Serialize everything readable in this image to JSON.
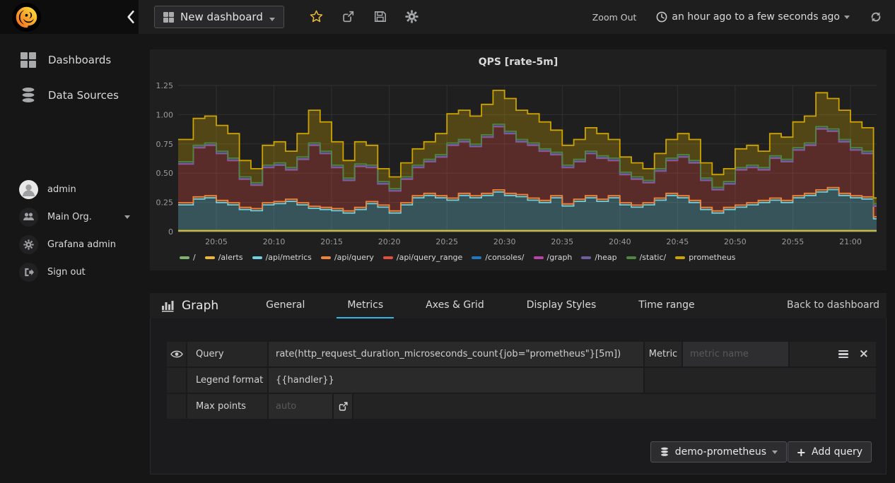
{
  "colors": {
    "accent": "#33b5e5",
    "star": "#EAB839",
    "panel_bg": "#1f1f20",
    "icon_gray": "#9fa0a2"
  },
  "header": {
    "dashboard_title": "New dashboard",
    "zoom_out_label": "Zoom Out",
    "time_range": "an hour ago to a few seconds ago"
  },
  "sidebar": {
    "items": [
      {
        "label": "Dashboards"
      },
      {
        "label": "Data Sources"
      }
    ],
    "user_items": [
      {
        "label": "admin"
      },
      {
        "label": "Main Org."
      },
      {
        "label": "Grafana admin"
      },
      {
        "label": "Sign out"
      }
    ]
  },
  "panel": {
    "title": "QPS [rate-5m]"
  },
  "chart_data": {
    "type": "area",
    "stacked": true,
    "step": true,
    "title": "QPS [rate-5m]",
    "xlabel": "",
    "ylabel": "",
    "ylim": [
      0,
      1.25
    ],
    "grid": true,
    "legend_position": "bottom",
    "x_start": "20:02",
    "x_step_minutes": 1,
    "x_ticks": [
      {
        "m": 5,
        "label": "20:05"
      },
      {
        "m": 10,
        "label": "20:10"
      },
      {
        "m": 15,
        "label": "20:15"
      },
      {
        "m": 20,
        "label": "20:20"
      },
      {
        "m": 25,
        "label": "20:25"
      },
      {
        "m": 30,
        "label": "20:30"
      },
      {
        "m": 35,
        "label": "20:35"
      },
      {
        "m": 40,
        "label": "20:40"
      },
      {
        "m": 45,
        "label": "20:45"
      },
      {
        "m": 50,
        "label": "20:50"
      },
      {
        "m": 55,
        "label": "20:55"
      },
      {
        "m": 60,
        "label": "21:00"
      }
    ],
    "y_ticks": [
      {
        "v": 0,
        "label": "0"
      },
      {
        "v": 0.25,
        "label": "0.25"
      },
      {
        "v": 0.5,
        "label": "0.50"
      },
      {
        "v": 0.75,
        "label": "0.75"
      },
      {
        "v": 1,
        "label": "1.00"
      },
      {
        "v": 1.25,
        "label": "1.25"
      }
    ],
    "series": [
      {
        "name": "/",
        "color": "#7EB26D",
        "value": 0.004
      },
      {
        "name": "/alerts",
        "color": "#EAB839",
        "value": 0.005
      },
      {
        "name": "/api/metrics",
        "color": "#6ED0E0",
        "values": [
          0.22,
          0.27,
          0.28,
          0.24,
          0.22,
          0.18,
          0.17,
          0.22,
          0.23,
          0.25,
          0.22,
          0.19,
          0.18,
          0.17,
          0.15,
          0.18,
          0.23,
          0.2,
          0.15,
          0.22,
          0.28,
          0.3,
          0.28,
          0.26,
          0.3,
          0.28,
          0.3,
          0.33,
          0.3,
          0.29,
          0.26,
          0.24,
          0.28,
          0.21,
          0.25,
          0.28,
          0.25,
          0.28,
          0.22,
          0.2,
          0.22,
          0.26,
          0.3,
          0.28,
          0.24,
          0.18,
          0.15,
          0.18,
          0.2,
          0.22,
          0.24,
          0.26,
          0.24,
          0.28,
          0.3,
          0.33,
          0.35,
          0.3,
          0.28,
          0.27,
          0.1
        ]
      },
      {
        "name": "/api/query",
        "color": "#EF843C",
        "value": 0.018
      },
      {
        "name": "/api/query_range",
        "color": "#E24D42",
        "values": [
          0.33,
          0.42,
          0.43,
          0.4,
          0.36,
          0.24,
          0.2,
          0.3,
          0.31,
          0.25,
          0.37,
          0.52,
          0.46,
          0.35,
          0.26,
          0.35,
          0.29,
          0.18,
          0.17,
          0.2,
          0.24,
          0.27,
          0.33,
          0.45,
          0.44,
          0.42,
          0.48,
          0.54,
          0.51,
          0.45,
          0.45,
          0.42,
          0.35,
          0.31,
          0.32,
          0.36,
          0.35,
          0.3,
          0.24,
          0.22,
          0.17,
          0.23,
          0.28,
          0.33,
          0.32,
          0.23,
          0.18,
          0.2,
          0.3,
          0.3,
          0.26,
          0.34,
          0.33,
          0.39,
          0.41,
          0.52,
          0.48,
          0.44,
          0.39,
          0.37,
          0.09
        ]
      },
      {
        "name": "/consoles/",
        "color": "#1F78C1",
        "value": 0.002
      },
      {
        "name": "/graph",
        "color": "#BA43A9",
        "value": 0.002
      },
      {
        "name": "/heap",
        "color": "#705DA0",
        "value": 0.002
      },
      {
        "name": "/static/",
        "color": "#508642",
        "value": 0.015
      },
      {
        "name": "prometheus",
        "color": "#CCA300",
        "values": [
          0.19,
          0.23,
          0.23,
          0.22,
          0.21,
          0.14,
          0.12,
          0.17,
          0.18,
          0.14,
          0.2,
          0.28,
          0.25,
          0.2,
          0.15,
          0.19,
          0.17,
          0.11,
          0.1,
          0.12,
          0.14,
          0.15,
          0.18,
          0.25,
          0.25,
          0.24,
          0.26,
          0.29,
          0.28,
          0.25,
          0.25,
          0.23,
          0.19,
          0.17,
          0.17,
          0.2,
          0.19,
          0.16,
          0.13,
          0.12,
          0.1,
          0.13,
          0.16,
          0.18,
          0.18,
          0.13,
          0.11,
          0.11,
          0.16,
          0.17,
          0.14,
          0.19,
          0.19,
          0.22,
          0.23,
          0.29,
          0.26,
          0.25,
          0.22,
          0.2,
          0.05
        ]
      }
    ]
  },
  "editor": {
    "panel_type": "Graph",
    "tabs": [
      "General",
      "Metrics",
      "Axes & Grid",
      "Display Styles",
      "Time range"
    ],
    "active_tab": "Metrics",
    "back_link": "Back to dashboard",
    "query_row": {
      "label": "Query",
      "value": "rate(http_request_duration_microseconds_count{job=\"prometheus\"}[5m])",
      "metric_label": "Metric",
      "metric_placeholder": "metric name"
    },
    "legend_row": {
      "label": "Legend format",
      "value": "{{handler}}"
    },
    "max_points_row": {
      "label": "Max points",
      "placeholder": "auto"
    },
    "datasource_button": "demo-prometheus",
    "add_query_button": "Add query"
  }
}
